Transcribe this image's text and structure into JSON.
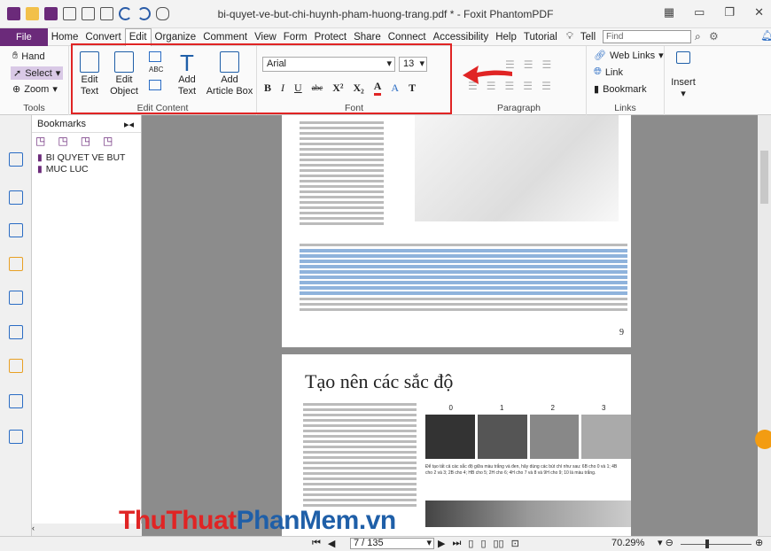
{
  "window": {
    "title": "bi-quyet-ve-but-chi-huynh-pham-huong-trang.pdf * - Foxit PhantomPDF"
  },
  "menu": {
    "file": "File",
    "items": [
      "Home",
      "Convert",
      "Edit",
      "Organize",
      "Comment",
      "View",
      "Form",
      "Protect",
      "Share",
      "Connect",
      "Accessibility",
      "Help",
      "Tutorial"
    ],
    "tell": "Tell",
    "find_placeholder": "Find"
  },
  "ribbon": {
    "tools": {
      "hand": "Hand",
      "select": "Select",
      "zoom": "Zoom",
      "label": "Tools"
    },
    "edit_content": {
      "edit_text_1": "Edit",
      "edit_text_2": "Text",
      "edit_object_1": "Edit",
      "edit_object_2": "Object",
      "add_text_1": "Add",
      "add_text_2": "Text",
      "add_article_1": "Add",
      "add_article_2": "Article Box",
      "label": "Edit Content"
    },
    "font": {
      "family": "Arial",
      "size": "13",
      "label": "Font",
      "b": "B",
      "i": "I",
      "u": "U",
      "abc": "abc",
      "sup": "X²",
      "sub": "X₂",
      "a1": "A",
      "a2": "A",
      "t": "T"
    },
    "paragraph": {
      "label": "Paragraph"
    },
    "links": {
      "web_links": "Web Links",
      "link": "Link",
      "bookmark": "Bookmark",
      "label": "Links"
    },
    "insert": {
      "label": "Insert"
    }
  },
  "bookmarks": {
    "title": "Bookmarks",
    "items": [
      "BI QUYET VE BUT",
      "MUC LUC"
    ]
  },
  "document": {
    "heading": "Tạo nên các sắc độ",
    "page_num": "9",
    "scale_labels": [
      "0",
      "1",
      "2",
      "3"
    ],
    "caption": "Để tạo tất cả các sắc độ giữa màu trắng và đen, hãy dùng các bút chì như sau: 6B cho 0 và 1; 4B cho 2 và 3; 2B cho 4; HB cho 5; 2H cho 6; 4H cho 7 và 8 và 9H cho 9; 10 là màu trắng."
  },
  "status": {
    "page": "7 / 135",
    "zoom": "70.29%"
  },
  "watermark": {
    "text": "ThuThuatPhanMem.vn",
    "parts": [
      "Thu",
      "Thuat",
      "Phan",
      "Mem",
      ".vn"
    ]
  },
  "colors": {
    "accent": "#6b2a7a",
    "highlight_box": "#e02424",
    "arrow": "#e02424"
  }
}
